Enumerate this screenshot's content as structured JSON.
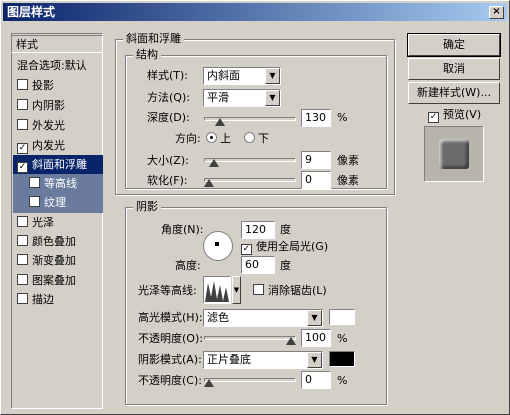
{
  "window": {
    "title": "图层样式",
    "close_glyph": "×"
  },
  "sidebar": {
    "header": "样式",
    "blend_options": "混合选项:默认",
    "items": [
      {
        "label": "投影",
        "checked": false
      },
      {
        "label": "内阴影",
        "checked": false
      },
      {
        "label": "外发光",
        "checked": false
      },
      {
        "label": "内发光",
        "checked": true
      },
      {
        "label": "斜面和浮雕",
        "checked": true
      },
      {
        "label": "等高线",
        "checked": false
      },
      {
        "label": "纹理",
        "checked": false
      },
      {
        "label": "光泽",
        "checked": false
      },
      {
        "label": "颜色叠加",
        "checked": false
      },
      {
        "label": "渐变叠加",
        "checked": false
      },
      {
        "label": "图案叠加",
        "checked": false
      },
      {
        "label": "描边",
        "checked": false
      }
    ]
  },
  "bevel": {
    "section_title": "斜面和浮雕",
    "structure_title": "结构",
    "style_label": "样式(T):",
    "style_value": "内斜面",
    "technique_label": "方法(Q):",
    "technique_value": "平滑",
    "depth_label": "深度(D):",
    "depth_value": "130",
    "depth_unit": "%",
    "depth_fraction": 0.13,
    "direction_label": "方向:",
    "direction_up": "上",
    "direction_down": "下",
    "size_label": "大小(Z):",
    "size_value": "9",
    "size_unit": "像素",
    "size_fraction": 0.06,
    "soften_label": "软化(F):",
    "soften_value": "0",
    "soften_unit": "像素",
    "soften_fraction": 0.0
  },
  "shading": {
    "title": "阴影",
    "angle_label": "角度(N):",
    "angle_value": "120",
    "angle_unit": "度",
    "global_light_label": "使用全局光(G)",
    "global_light_checked": true,
    "altitude_label": "高度:",
    "altitude_value": "60",
    "altitude_unit": "度",
    "gloss_contour_label": "光泽等高线:",
    "anti_alias_label": "消除锯齿(L)",
    "anti_alias_checked": false,
    "highlight_mode_label": "高光模式(H):",
    "highlight_mode_value": "滤色",
    "highlight_color": "#ffffff",
    "highlight_opacity_label": "不透明度(O):",
    "highlight_opacity_value": "100",
    "highlight_opacity_unit": "%",
    "highlight_opacity_fraction": 1.0,
    "shadow_mode_label": "阴影模式(A):",
    "shadow_mode_value": "正片叠底",
    "shadow_color": "#000000",
    "shadow_opacity_label": "不透明度(C):",
    "shadow_opacity_value": "0",
    "shadow_opacity_unit": "%",
    "shadow_opacity_fraction": 0.0
  },
  "buttons": {
    "ok": "确定",
    "cancel": "取消",
    "new_style": "新建样式(W)...",
    "preview_label": "预览(V)",
    "preview_checked": true
  }
}
